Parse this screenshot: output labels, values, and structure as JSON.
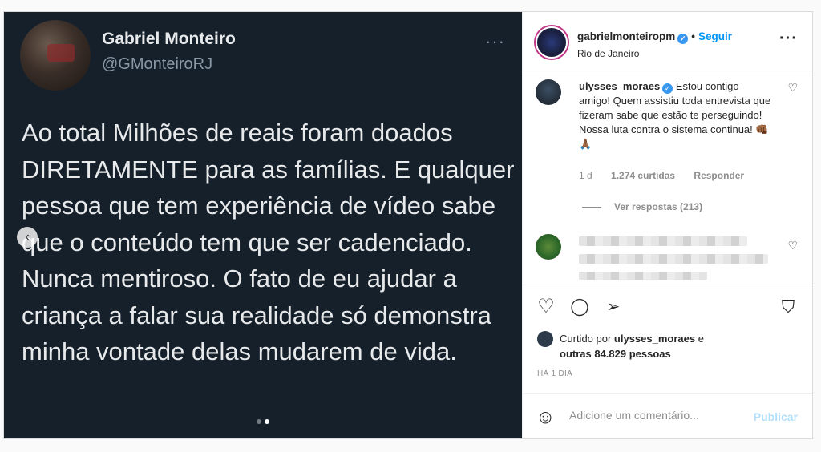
{
  "tweet": {
    "name": "Gabriel Monteiro",
    "handle": "@GMonteiroRJ",
    "more": "···",
    "text": "Ao total Milhões de reais foram doados DIRETAMENTE para as famílias. E qualquer pessoa que tem experiência de vídeo sabe que o conteúdo tem que ser cadenciado. Nunca mentiroso. O fato de eu ajudar a criança a falar sua realidade só demonstra minha vontade delas mudarem de vida."
  },
  "carousel": {
    "prev_icon": "‹",
    "slide_count": 2,
    "active_slide": 2
  },
  "header": {
    "username": "gabrielmonteiropm",
    "verified_icon": "✓",
    "separator": "•",
    "follow": "Seguir",
    "location": "Rio de Janeiro",
    "more": "···"
  },
  "comment": {
    "username": "ulysses_moraes",
    "verified_icon": "✓",
    "text": "Estou contigo amigo! Quem assistiu toda entrevista que fizeram sabe que estão te perseguindo! Nossa luta contra o sistema continua! 👊🏾🙏🏾",
    "time": "1 d",
    "likes": "1.274 curtidas",
    "reply": "Responder",
    "view_replies": "Ver respostas (213)",
    "heart_icon": "♡"
  },
  "comment2": {
    "heart_icon": "♡"
  },
  "actions": {
    "like_icon": "♡",
    "comment_icon": "◯",
    "share_icon": "➢",
    "save_icon": "⛉"
  },
  "likes": {
    "prefix": "Curtido por ",
    "user": "ulysses_moraes",
    "suffix": " e",
    "others": "outras 84.829 pessoas"
  },
  "time": "HÁ 1 DIA",
  "add_comment": {
    "emoji_icon": "☺",
    "placeholder": "Adicione um comentário...",
    "publish": "Publicar"
  }
}
